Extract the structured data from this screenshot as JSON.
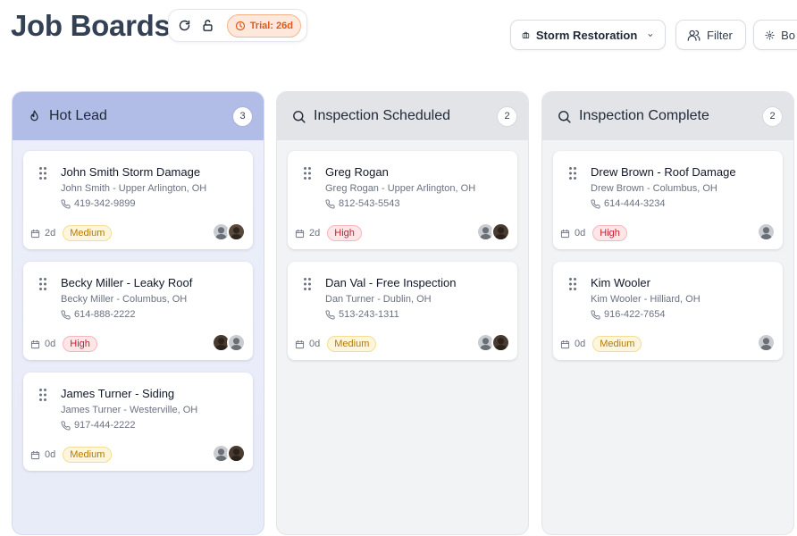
{
  "page": {
    "title": "Job Boards"
  },
  "tools": {
    "refresh_icon": "refresh-icon",
    "lock_icon": "lock-icon",
    "trial_label": "Trial: 26d"
  },
  "header": {
    "company_label": "Storm Restoration",
    "filter_label": "Filter",
    "board_label": "Bo"
  },
  "colors": {
    "hot_header": "#b1bde6",
    "medium": "#b07b09",
    "high": "#c72030",
    "trial": "#e0591a"
  },
  "columns": [
    {
      "title": "Hot Lead",
      "count": "3",
      "icon": "flame-icon",
      "cards": [
        {
          "title": "John Smith Storm Damage",
          "subtitle": "John Smith - Upper Arlington, OH",
          "phone": "419-342-9899",
          "age": "2d",
          "priority": "Medium"
        },
        {
          "title": "Becky Miller - Leaky Roof",
          "subtitle": "Becky Miller - Columbus, OH",
          "phone": "614-888-2222",
          "age": "0d",
          "priority": "High"
        },
        {
          "title": "James Turner - Siding",
          "subtitle": "James Turner - Westerville, OH",
          "phone": "917-444-2222",
          "age": "0d",
          "priority": "Medium"
        }
      ]
    },
    {
      "title": "Inspection Scheduled",
      "count": "2",
      "icon": "search-icon",
      "cards": [
        {
          "title": "Greg Rogan",
          "subtitle": "Greg Rogan - Upper Arlington, OH",
          "phone": "812-543-5543",
          "age": "2d",
          "priority": "High"
        },
        {
          "title": "Dan Val - Free Inspection",
          "subtitle": "Dan Turner - Dublin, OH",
          "phone": "513-243-1311",
          "age": "0d",
          "priority": "Medium"
        }
      ]
    },
    {
      "title": "Inspection Complete",
      "count": "2",
      "icon": "search-icon",
      "cards": [
        {
          "title": "Drew Brown - Roof Damage",
          "subtitle": "Drew Brown - Columbus, OH",
          "phone": "614-444-3234",
          "age": "0d",
          "priority": "High"
        },
        {
          "title": "Kim Wooler",
          "subtitle": "Kim Wooler - Hilliard, OH",
          "phone": "916-422-7654",
          "age": "0d",
          "priority": "Medium"
        }
      ]
    }
  ]
}
